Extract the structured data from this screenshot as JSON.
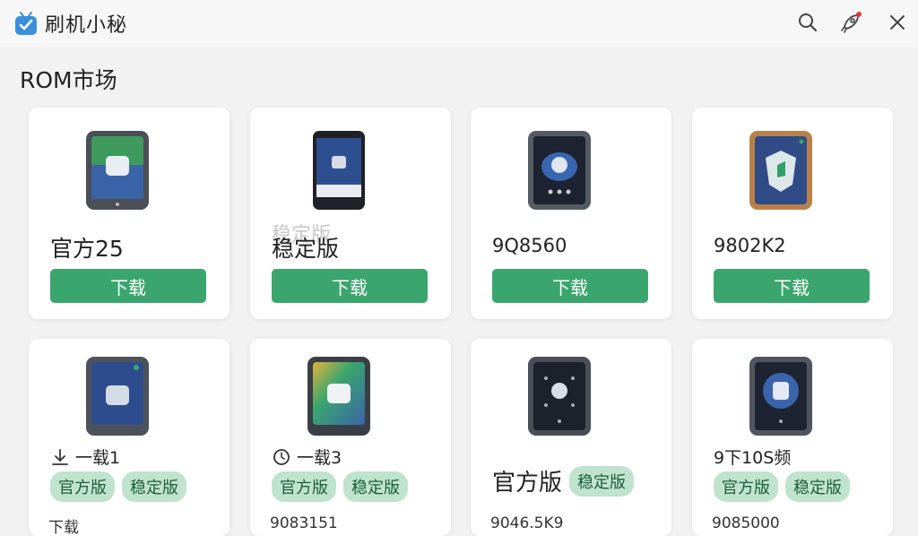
{
  "app": {
    "title": "刷机小秘"
  },
  "toolbar": {
    "search_icon": "search-icon",
    "share_icon": "rocket-icon",
    "close_icon": "close-icon"
  },
  "section": {
    "title": "ROM市场"
  },
  "colors": {
    "accent": "#3aa66d",
    "tag_bg": "#bfe3cc",
    "notify_dot": "#e03a3a"
  },
  "row1": [
    {
      "title": "官方25",
      "button": "下载",
      "device": "green-screen-phone"
    },
    {
      "title": "稳定版",
      "ghost": "稳定版",
      "button": "下载",
      "device": "dark-phone"
    },
    {
      "title": "9Q8560",
      "button": "下载",
      "device": "chat-phone"
    },
    {
      "title": "9802K2",
      "button": "下载",
      "device": "shield-phone"
    }
  ],
  "row2": [
    {
      "meta": "一载1",
      "tags": [
        "官方版",
        "稳定版"
      ],
      "cut": "下载"
    },
    {
      "meta": "一载3",
      "tags": [
        "官方版",
        "稳定版"
      ],
      "cut": "9083151"
    },
    {
      "title": "官方版",
      "tags": [
        "稳定版"
      ],
      "cut": "9046.5K9"
    },
    {
      "meta": "9下10S频",
      "tags": [
        "官方版",
        "稳定版"
      ],
      "cut": "9085000"
    }
  ]
}
